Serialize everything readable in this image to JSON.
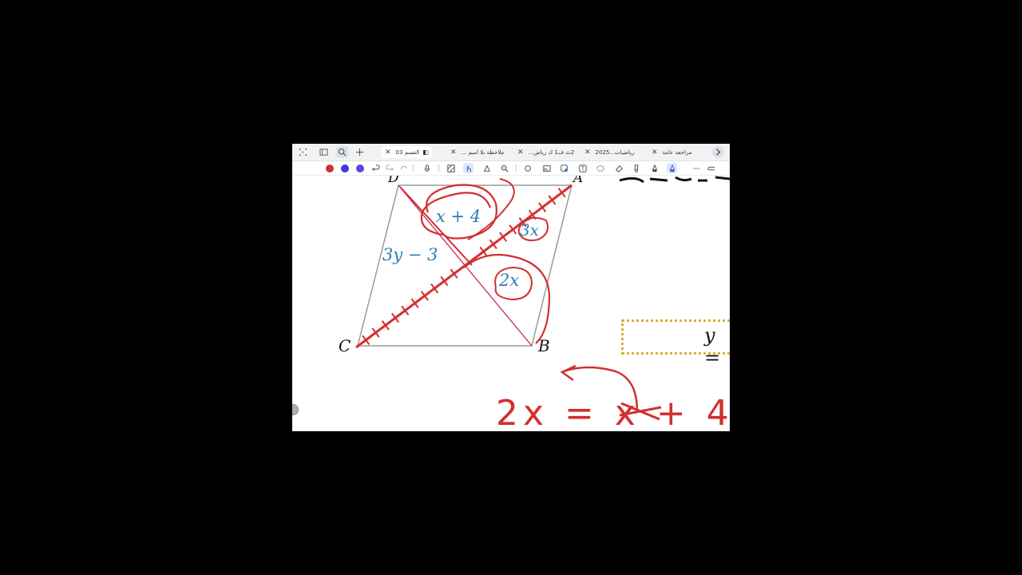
{
  "tabs": [
    {
      "title": "مراجعة عامة",
      "active": false
    },
    {
      "title": "رياضيات...2025",
      "active": false
    },
    {
      "title": "2ث ف1 ك رياض...",
      "active": false
    },
    {
      "title": "ملاحظة بلا اسم ...",
      "active": false
    },
    {
      "title": "القسم 03",
      "active": true
    }
  ],
  "toolbar": {
    "pen_colors": [
      "#d32f2f",
      "#3f3ad8",
      "#5a48e0"
    ]
  },
  "figure": {
    "vertex_labels": {
      "a": "A",
      "b": "B",
      "c": "C",
      "d": "D"
    },
    "segment_labels": {
      "top": "x + 4",
      "right": "3x",
      "bottom": "2x",
      "left": "3y − 3"
    }
  },
  "answer_box_text": "y =",
  "handwritten_equation": "2x = x + 4",
  "colors": {
    "ink": "#d32f2f",
    "math_blue": "#2a7fb6",
    "box_border": "#d3b23a"
  }
}
